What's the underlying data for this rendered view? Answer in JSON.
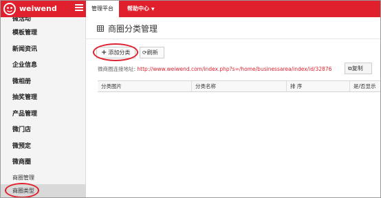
{
  "brand": {
    "name": "weiwend"
  },
  "topbar": {
    "tab_manage": "管理平台",
    "tab_help": "帮助中心",
    "caret": "▼"
  },
  "sidebar": {
    "items": [
      {
        "label": "微活动",
        "type": "main"
      },
      {
        "label": "模板管理",
        "type": "main"
      },
      {
        "label": "新闻资讯",
        "type": "main"
      },
      {
        "label": "企业信息",
        "type": "main"
      },
      {
        "label": "微相册",
        "type": "main"
      },
      {
        "label": "抽奖管理",
        "type": "main"
      },
      {
        "label": "产品管理",
        "type": "main"
      },
      {
        "label": "微门店",
        "type": "main"
      },
      {
        "label": "微预定",
        "type": "main"
      },
      {
        "label": "微商圈",
        "type": "main"
      },
      {
        "label": "商圈管理",
        "type": "sub"
      },
      {
        "label": "商圈类型",
        "type": "sub",
        "active": true
      }
    ]
  },
  "main": {
    "title": "商圈分类管理",
    "add_button": "添加分类",
    "refresh_button": "刷新",
    "link_label": "微商圈连接地址:",
    "link_url": "http://www.weiwend.com/index.php?s=/home/businessarea/index/id/32876",
    "copy_button": "复制",
    "table": {
      "columns": [
        "分类图片",
        "分类名称",
        "排 序",
        "是/否显示"
      ]
    }
  },
  "colors": {
    "accent": "#e0202d",
    "sidebar_bg": "#f4f4f4"
  }
}
